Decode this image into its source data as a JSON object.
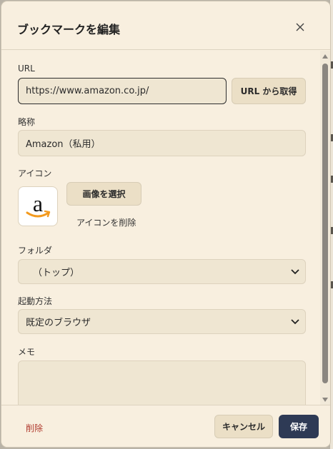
{
  "dialog": {
    "title": "ブックマークを編集"
  },
  "form": {
    "url": {
      "label": "URL",
      "value": "https://www.amazon.co.jp/",
      "fetch_button": "URL から取得"
    },
    "short_name": {
      "label": "略称",
      "value": "Amazon（私用）"
    },
    "icon": {
      "label": "アイコン",
      "select_button": "画像を選択",
      "delete_link": "アイコンを削除",
      "image": "amazon-logo"
    },
    "folder": {
      "label": "フォルダ",
      "selected": "（トップ）"
    },
    "launch_method": {
      "label": "起動方法",
      "selected": "既定のブラウザ"
    },
    "memo": {
      "label": "メモ",
      "value": ""
    }
  },
  "footer": {
    "delete_label": "削除",
    "cancel_label": "キャンセル",
    "save_label": "保存"
  },
  "colors": {
    "dialog_bg": "#f8efdf",
    "field_bg": "#efe6d2",
    "primary": "#2e3a55",
    "danger": "#b03a2e"
  },
  "icons": [
    "close-icon",
    "chevron-down-icon",
    "scroll-up-icon",
    "scroll-down-icon"
  ]
}
